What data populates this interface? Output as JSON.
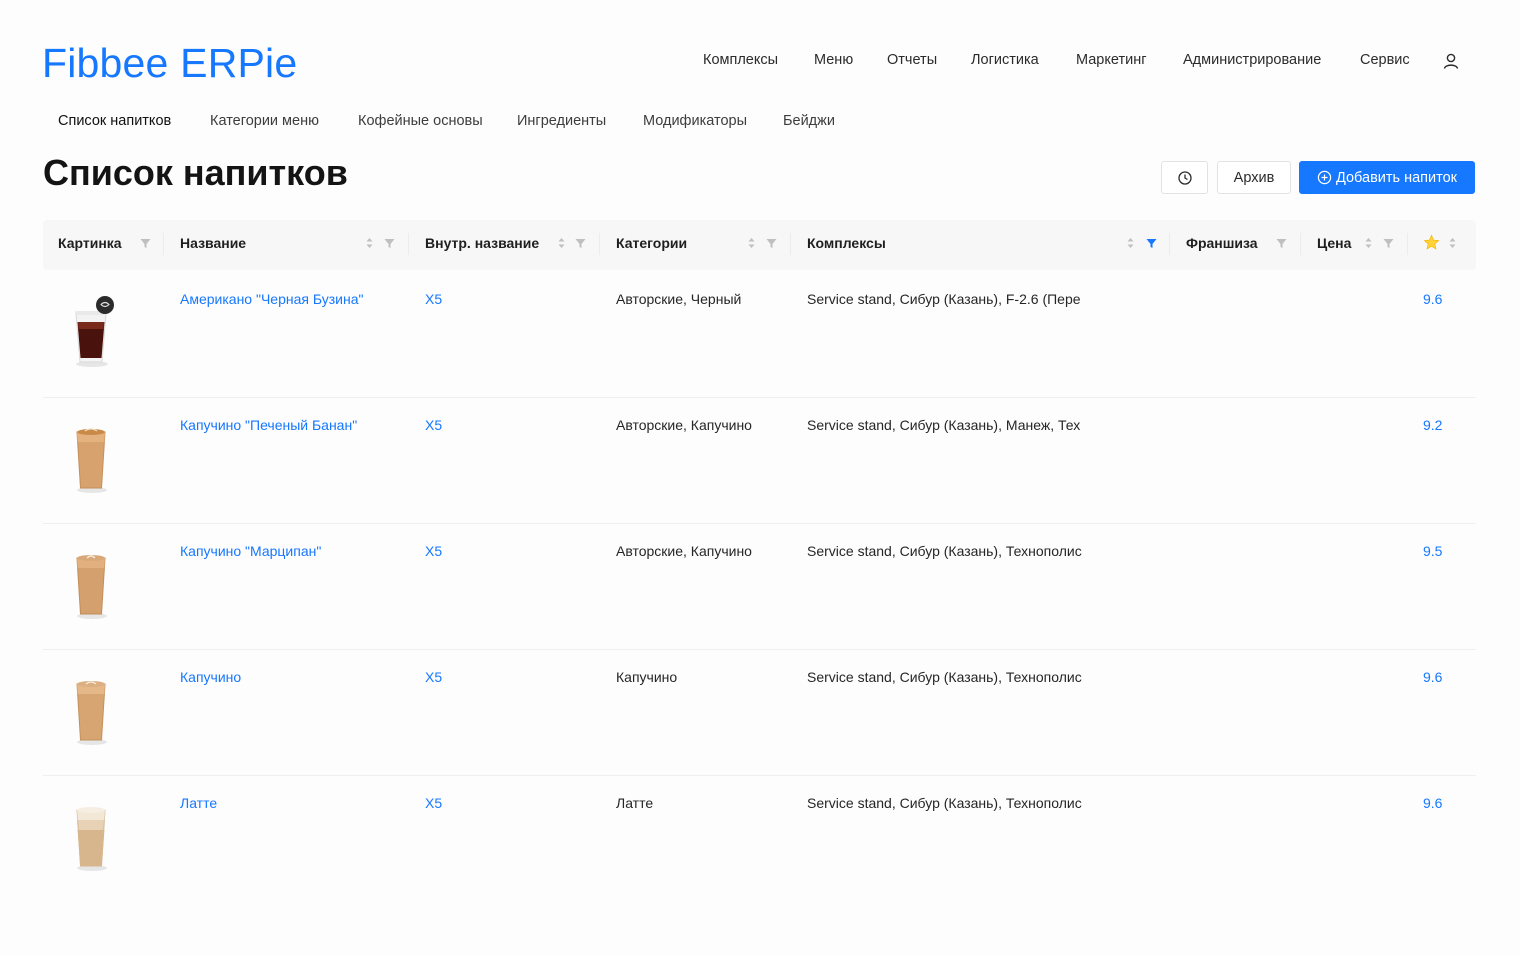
{
  "app": {
    "logo": "Fibbee ERPie",
    "accent_color": "#1677ff"
  },
  "topnav": {
    "items": [
      "Комплексы",
      "Меню",
      "Отчеты",
      "Логистика",
      "Маркетинг",
      "Администрирование",
      "Сервис"
    ],
    "user_icon": "user-icon"
  },
  "subnav": {
    "active": "Список напитков",
    "items": [
      "Список напитков",
      "Категории меню",
      "Кофейные основы",
      "Ингредиенты",
      "Модификаторы",
      "Бейджи"
    ]
  },
  "page": {
    "title": "Список напитков",
    "history_icon": "clock-icon",
    "archive_label": "Архив",
    "add_label": "Добавить напиток"
  },
  "table": {
    "columns": [
      "Картинка",
      "Название",
      "Внутр. название",
      "Категории",
      "Комплексы",
      "Франшиза",
      "Цена"
    ],
    "rating_icon": "star-icon",
    "active_filter_column": "Комплексы",
    "rows": [
      {
        "image": "iced-americano-cup",
        "name": "Американо \"Черная Бузина\"",
        "internal": "X5",
        "categories": "Авторские, Черный",
        "complexes": "Service stand, Сибур (Казань), F-2.6 (Пере",
        "franchise": "",
        "price": "",
        "rating": "9.6"
      },
      {
        "image": "cappuccino-cup",
        "name": "Капучино \"Печеный Банан\"",
        "internal": "X5",
        "categories": "Авторские, Капучино",
        "complexes": "Service stand, Сибур (Казань), Манеж, Тех",
        "franchise": "",
        "price": "",
        "rating": "9.2"
      },
      {
        "image": "cappuccino-cup",
        "name": "Капучино \"Марципан\"",
        "internal": "X5",
        "categories": "Авторские, Капучино",
        "complexes": "Service stand, Сибур (Казань), Технополис",
        "franchise": "",
        "price": "",
        "rating": "9.5"
      },
      {
        "image": "cappuccino-cup",
        "name": "Капучино",
        "internal": "X5",
        "categories": "Капучино",
        "complexes": "Service stand, Сибур (Казань), Технополис",
        "franchise": "",
        "price": "",
        "rating": "9.6"
      },
      {
        "image": "latte-cup",
        "name": "Латте",
        "internal": "X5",
        "categories": "Латте",
        "complexes": "Service stand, Сибур (Казань), Технополис",
        "franchise": "",
        "price": "",
        "rating": "9.6"
      }
    ]
  }
}
